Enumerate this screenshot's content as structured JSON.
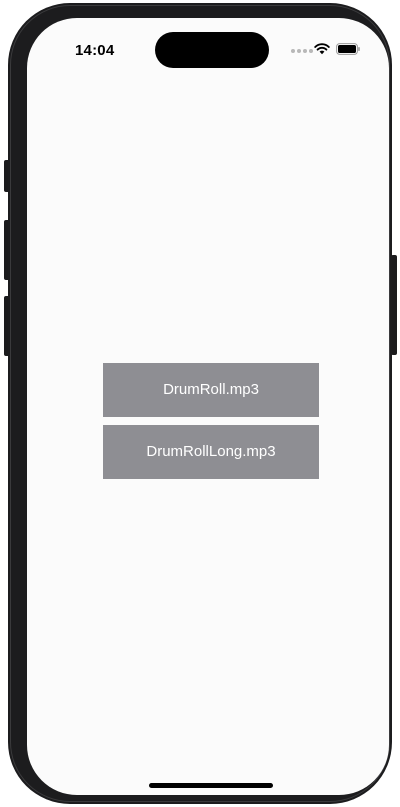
{
  "status_bar": {
    "time": "14:04",
    "icons": [
      "signal-icon",
      "wifi-icon",
      "battery-icon"
    ]
  },
  "buttons": [
    {
      "label": "DrumRoll.mp3"
    },
    {
      "label": "DrumRollLong.mp3"
    }
  ],
  "colors": {
    "button_background": "#8e8e93",
    "button_text": "#ffffff",
    "screen_background": "#fbfbfb",
    "device_frame": "#1c1c1e"
  }
}
